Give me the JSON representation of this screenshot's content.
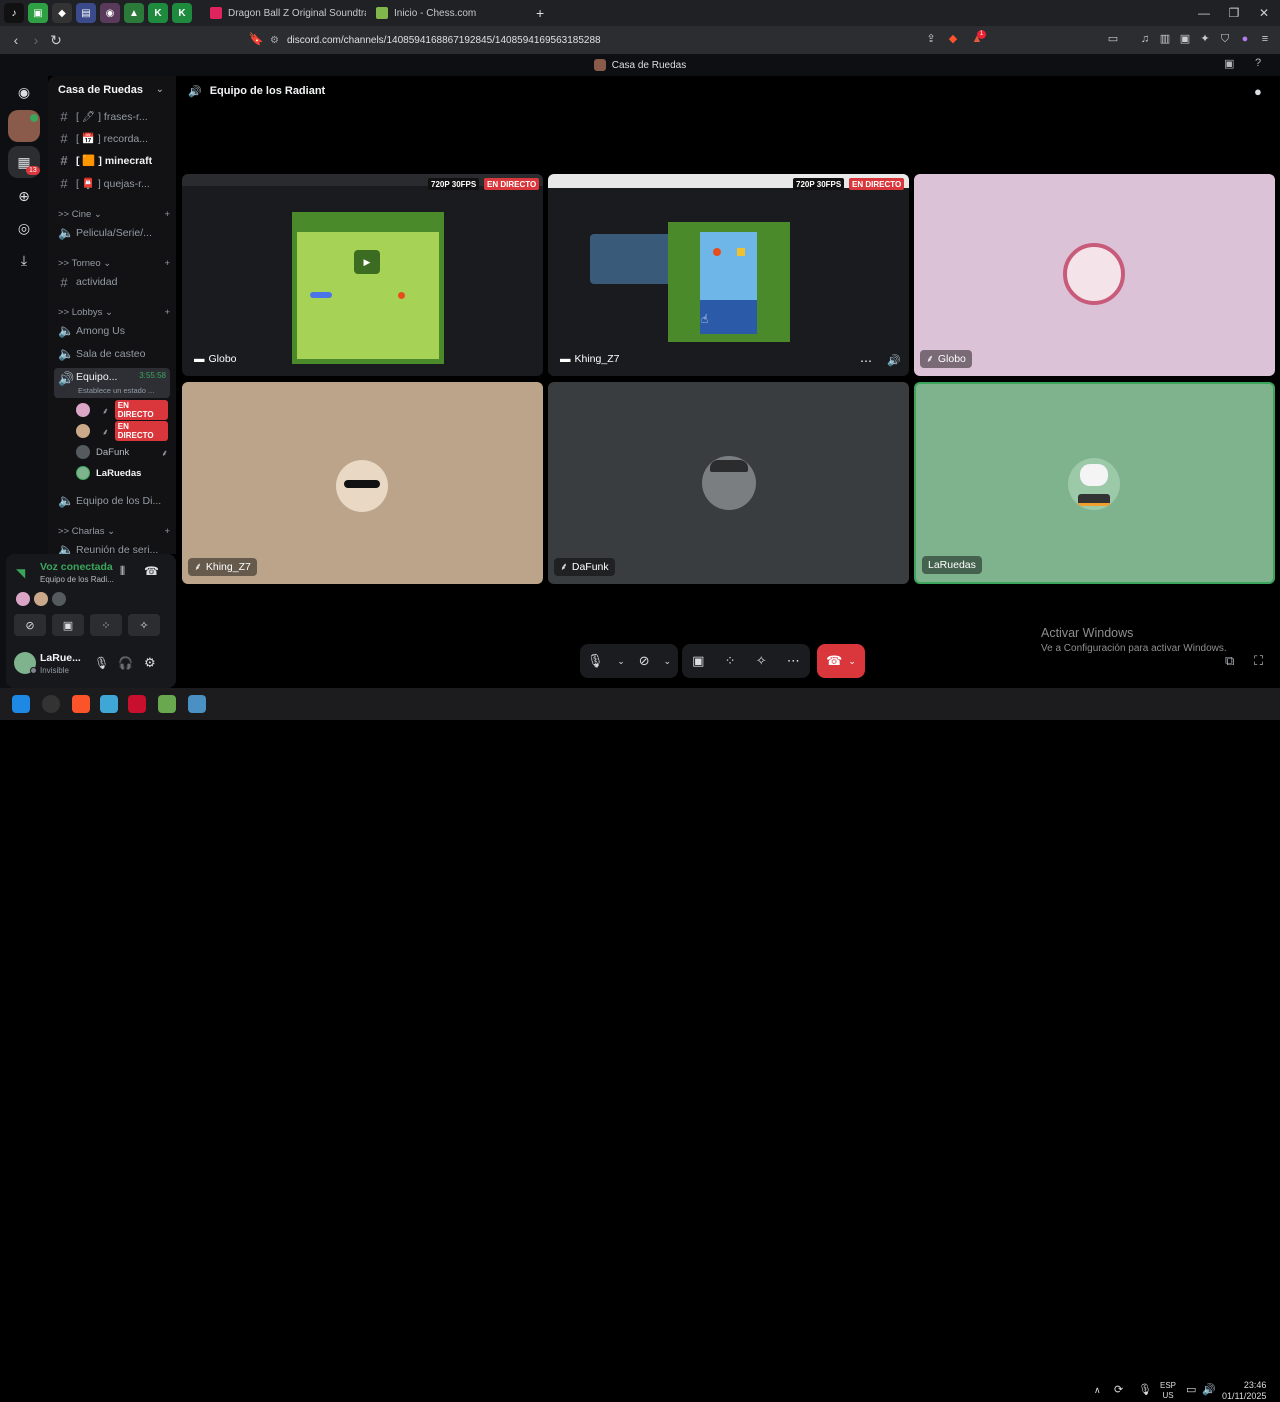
{
  "browser": {
    "tabs": [
      {
        "title": "Dragon Ball Z Original Soundtrack - ",
        "favicon_color": "#e0245e"
      },
      {
        "title": "Inicio - Chess.com",
        "favicon_color": "#81b64c"
      }
    ],
    "new_tab_label": "+",
    "url": "discord.com/channels/1408594168867192845/1408594169563185288",
    "brave_badge": "1"
  },
  "discord_title": "Casa de Ruedas",
  "rail": {
    "mention_count": "13"
  },
  "sidebar": {
    "server_name": "Casa de Ruedas",
    "channels_top": [
      {
        "label": "[ 🖊 ] frases-r..."
      },
      {
        "label": "[ 📅 ] recorda..."
      },
      {
        "label": "[ 🟧 ] minecraft"
      },
      {
        "label": "[ 📮 ] quejas-r..."
      }
    ],
    "cat_cine": ">> Cine ⌄",
    "chan_pelicula": "Pelicula/Serie/...",
    "cat_torneo": ">> Torneo ⌄",
    "chan_actividad": "actividad",
    "cat_lobbys": ">> Lobbys ⌄",
    "chan_among": "Among Us",
    "chan_sala": "Sala de casteo",
    "chan_equipo": "Equipo...",
    "chan_equipo_time": "3:55:58",
    "chan_equipo_status": "Establece un estado ...",
    "voice_users": [
      {
        "name": "",
        "live": "EN DIRECTO"
      },
      {
        "name": "",
        "live": "EN DIRECTO"
      },
      {
        "name": "DaFunk",
        "live": ""
      },
      {
        "name": "LaRuedas",
        "live": ""
      }
    ],
    "chan_equipo2": "Equipo de los Di...",
    "cat_charlas": ">> Charlas ⌄",
    "chan_reunion": "Reunión de seri..."
  },
  "voice_panel": {
    "status": "Voz conectada",
    "channel": "Equipo de los Radi...",
    "user_name": "LaRue...",
    "user_status": "Invisible"
  },
  "voice": {
    "channel_title": "Equipo de los Radiant",
    "tiles": [
      {
        "name": "Globo",
        "quality": "720P 30FPS",
        "live": "EN DIRECTO"
      },
      {
        "name": "Khing_Z7",
        "quality": "720P 30FPS",
        "live": "EN DIRECTO"
      },
      {
        "name": "Globo"
      },
      {
        "name": "Khing_Z7"
      },
      {
        "name": "DaFunk"
      },
      {
        "name": "LaRuedas"
      }
    ]
  },
  "watermark": {
    "title": "Activar Windows",
    "subtitle": "Ve a Configuración para activar Windows."
  },
  "taskbar": {
    "lang_top": "ESP",
    "lang_bottom": "US",
    "time": "23:46",
    "date": "01/11/2025"
  },
  "colors": {
    "tile_pink": "#dcc2d6",
    "tile_tan": "#bba48a",
    "tile_slate": "#3a3d3f",
    "tile_green": "#7fb38e",
    "speaking_border": "#3ba55c",
    "live_red": "#da373c",
    "game_green": "#a6d356"
  }
}
